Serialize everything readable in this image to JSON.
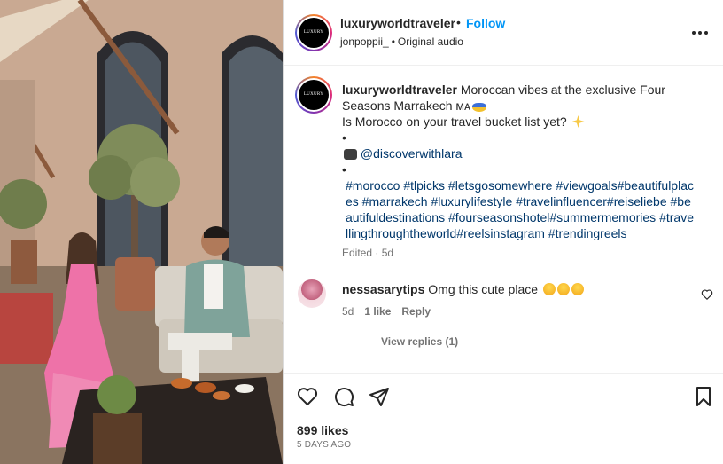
{
  "post": {
    "username": "luxuryworldtraveler",
    "dot": "•",
    "follow_label": "Follow",
    "sub_user": "jonpoppii_",
    "sub_sep": "•",
    "sub_audio": "Original audio",
    "avatar_text": "LUXURY WORLD TRAVELER"
  },
  "caption": {
    "username": "luxuryworldtraveler",
    "line1": "Moroccan vibes at the exclusive Four Seasons Marrakech ᴍᴀ",
    "line2": "Is Morocco on your travel bucket list yet?",
    "bullet": "•",
    "mention": "@discoverwithlara",
    "hashtags": "#morocco #tlpicks #letsgosomewhere #viewgoals#beautifulplaces #marrakech #luxurylifestyle #travelinfluencer#reiseliebe #beautifuldestinations #fourseasonshotel#summermemories #travellingthroughtheworld#reelsinstagram #trendingreels",
    "edited": "Edited · 5d"
  },
  "comment": {
    "username": "nessasarytips",
    "text": "Omg this cute place",
    "age": "5d",
    "likes": "1 like",
    "reply": "Reply",
    "view_replies": "View replies (1)"
  },
  "footer": {
    "likes": "899 likes",
    "date": "5 DAYS AGO"
  },
  "icons": {
    "like": "heart-icon",
    "comment": "comment-icon",
    "share": "share-icon",
    "save": "bookmark-icon",
    "more": "more-icon"
  },
  "colors": {
    "follow": "#0095f6",
    "hashtag": "#00376b",
    "muted": "#737373"
  }
}
